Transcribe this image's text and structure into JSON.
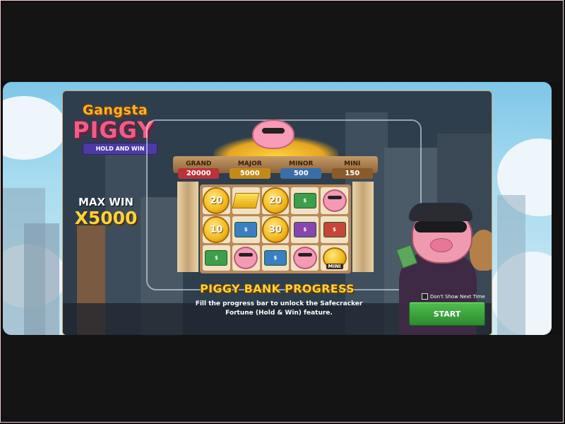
{
  "game": {
    "title_line1": "Gangsta",
    "title_line2": "PIGGY",
    "title_ribbon": "HOLD AND WIN"
  },
  "max_win": {
    "label": "MAX WIN",
    "value": "X5000"
  },
  "jackpots": [
    {
      "label": "GRAND",
      "value": "20000",
      "color": "#b8343a"
    },
    {
      "label": "MAJOR",
      "value": "5000",
      "color": "#c28a19"
    },
    {
      "label": "MINOR",
      "value": "500",
      "color": "#3b6ea8"
    },
    {
      "label": "MINI",
      "value": "150",
      "color": "#8a5a2b"
    }
  ],
  "reels": [
    [
      {
        "type": "coin",
        "value": "20"
      },
      {
        "type": "bar",
        "value": ""
      },
      {
        "type": "coin",
        "value": "20"
      },
      {
        "type": "cash",
        "value": "$"
      },
      {
        "type": "pig",
        "value": ""
      }
    ],
    [
      {
        "type": "coin",
        "value": "10"
      },
      {
        "type": "cash",
        "value": "$"
      },
      {
        "type": "coin",
        "value": "30"
      },
      {
        "type": "cash",
        "value": "$"
      },
      {
        "type": "cash",
        "value": "$"
      }
    ],
    [
      {
        "type": "cash",
        "value": "$"
      },
      {
        "type": "pig",
        "value": ""
      },
      {
        "type": "cash",
        "value": "$"
      },
      {
        "type": "pig",
        "value": ""
      },
      {
        "type": "coinbag",
        "value": "MINI"
      }
    ]
  ],
  "feature": {
    "title": "PIGGY BANK PROGRESS",
    "description": "Fill the progress bar to unlock the Safecracker Fortune (Hold & Win) feature."
  },
  "controls": {
    "dont_show_label": "Don't Show Next Time",
    "start_label": "START"
  },
  "icons": {
    "checkbox": "checkbox-icon",
    "piggy_bank": "piggy-bank-icon",
    "gangster": "gangster-pig-icon"
  }
}
